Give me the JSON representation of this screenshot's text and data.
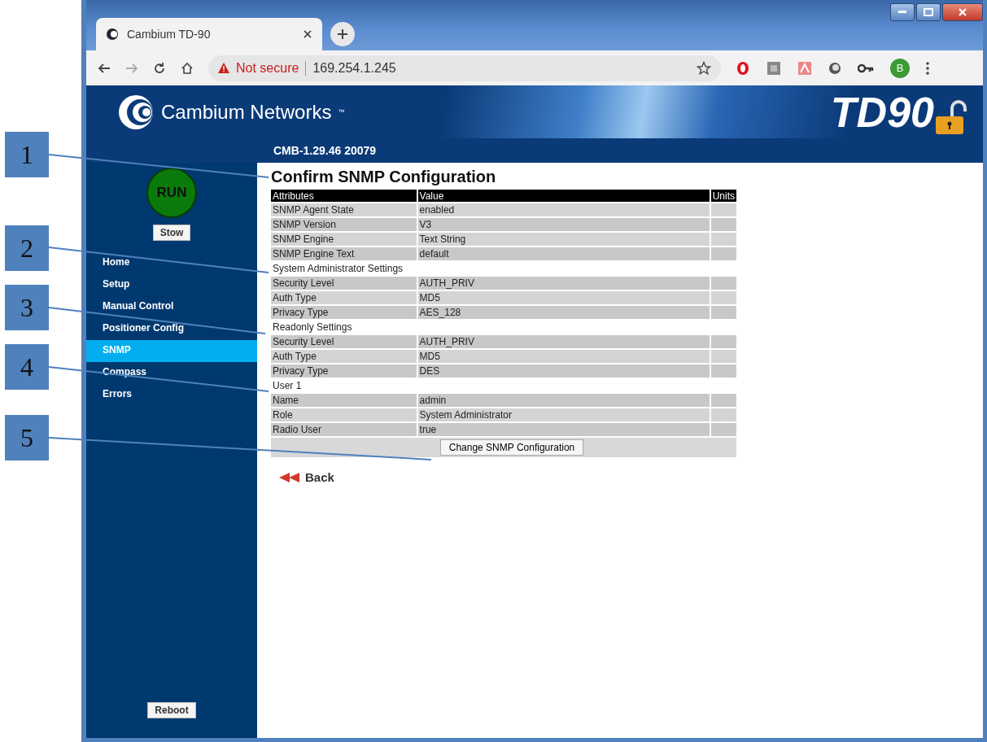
{
  "browser": {
    "tab_title": "Cambium TD-90",
    "url_warning": "Not secure",
    "url": "169.254.1.245",
    "profile": "B"
  },
  "header": {
    "brand": "Cambium Networks",
    "trademark": "™",
    "product": "TD90",
    "version": "CMB-1.29.46 20079"
  },
  "sidebar": {
    "status": "RUN",
    "stow": "Stow",
    "reboot": "Reboot",
    "items": [
      {
        "label": "Home",
        "selected": false
      },
      {
        "label": "Setup",
        "selected": false
      },
      {
        "label": "Manual Control",
        "selected": false
      },
      {
        "label": "Positioner Config",
        "selected": false
      },
      {
        "label": "SNMP",
        "selected": true
      },
      {
        "label": "Compass",
        "selected": false
      },
      {
        "label": "Errors",
        "selected": false
      }
    ]
  },
  "content": {
    "title": "Confirm SNMP Configuration",
    "table": {
      "columns": [
        "Attributes",
        "Value",
        "Units"
      ],
      "rows": [
        {
          "kind": "data",
          "attribute": "SNMP Agent State",
          "value": "enabled"
        },
        {
          "kind": "data",
          "attribute": "SNMP Version",
          "value": "V3"
        },
        {
          "kind": "data",
          "attribute": "SNMP Engine",
          "value": "Text String"
        },
        {
          "kind": "data",
          "attribute": "SNMP Engine Text",
          "value": "default"
        },
        {
          "kind": "section",
          "attribute": "System Administrator Settings"
        },
        {
          "kind": "data",
          "attribute": "Security Level",
          "value": "AUTH_PRIV"
        },
        {
          "kind": "data",
          "attribute": "Auth Type",
          "value": "MD5"
        },
        {
          "kind": "data",
          "attribute": "Privacy Type",
          "value": "AES_128"
        },
        {
          "kind": "section",
          "attribute": "Readonly Settings"
        },
        {
          "kind": "data",
          "attribute": "Security Level",
          "value": "AUTH_PRIV"
        },
        {
          "kind": "data",
          "attribute": "Auth Type",
          "value": "MD5"
        },
        {
          "kind": "data",
          "attribute": "Privacy Type",
          "value": "DES"
        },
        {
          "kind": "section",
          "attribute": "User 1"
        },
        {
          "kind": "data",
          "attribute": "Name",
          "value": "admin"
        },
        {
          "kind": "data",
          "attribute": "Role",
          "value": "System Administrator"
        },
        {
          "kind": "data",
          "attribute": "Radio User",
          "value": "true"
        }
      ]
    },
    "button": "Change SNMP Configuration",
    "back": "Back"
  },
  "callouts": [
    "1",
    "2",
    "3",
    "4",
    "5"
  ]
}
